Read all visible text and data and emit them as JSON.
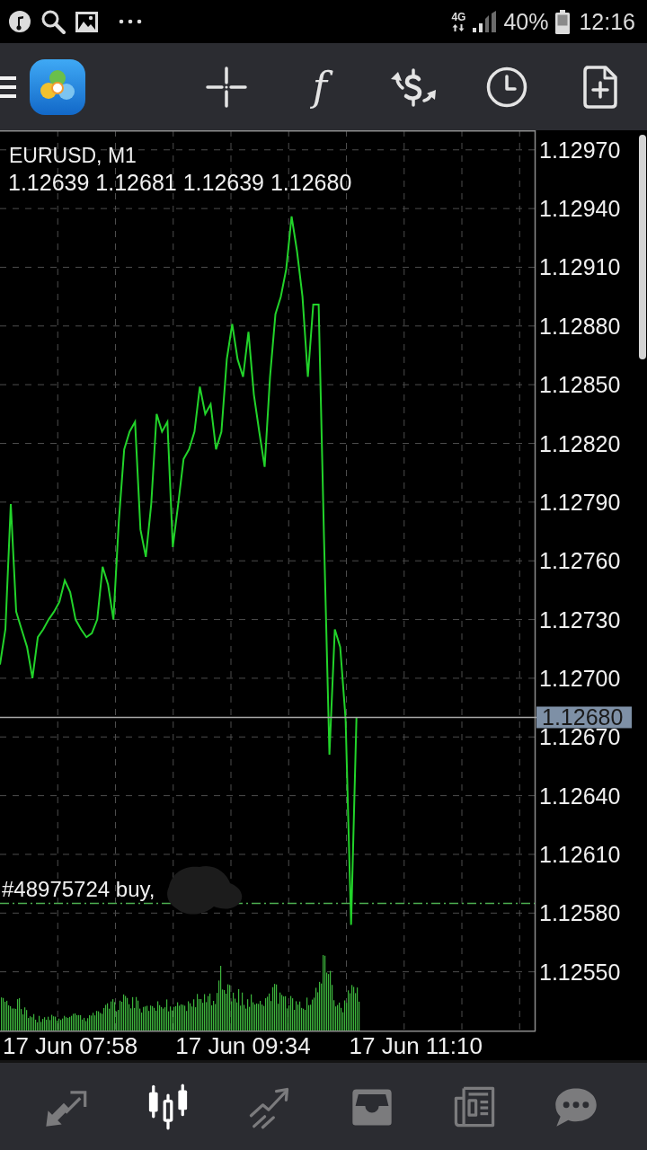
{
  "status_bar": {
    "network_type": "4G",
    "battery_percent": "40%",
    "time": "12:16"
  },
  "toolbar": {
    "buttons": [
      {
        "kind": "crosshair"
      },
      {
        "kind": "glyph",
        "glyph": "f"
      },
      {
        "kind": "dollar_arrows"
      },
      {
        "kind": "clock"
      },
      {
        "kind": "doc_plus"
      }
    ]
  },
  "chart": {
    "ohlc": "1.12639 1.12681 1.12639 1.12680",
    "chart_data": {
      "type": "line",
      "title": "EURUSD, M1",
      "grid": true,
      "categories": [
        null,
        null,
        null,
        null,
        null,
        null,
        null,
        null,
        null,
        null,
        null,
        null,
        null,
        "17 Jun 07:58",
        null,
        null,
        null,
        null,
        null,
        null,
        null,
        null,
        null,
        null,
        null,
        null,
        null,
        null,
        null,
        null,
        null,
        null,
        null,
        null,
        null,
        null,
        null,
        null,
        null,
        null,
        null,
        null,
        null,
        null,
        null,
        "17 Jun 09:34",
        null,
        null,
        null,
        null,
        null,
        null,
        null,
        null,
        null,
        null,
        null,
        null,
        null,
        null,
        null,
        null,
        null,
        null,
        null,
        null,
        null,
        null,
        null,
        null,
        null,
        null,
        null,
        null,
        null,
        null,
        null,
        "17 Jun 11:10",
        null,
        null,
        null,
        null,
        null,
        null,
        null,
        null,
        null,
        null,
        null,
        null,
        null,
        null,
        null,
        null,
        null,
        null,
        null,
        null,
        null,
        null
      ],
      "series": [
        {
          "color": "#22d32a",
          "values": [
            1.12707,
            1.12725,
            1.12789,
            1.12734,
            1.12725,
            1.12716,
            1.127,
            1.12721,
            1.12725,
            1.1273,
            1.12734,
            1.12739,
            1.1275,
            1.12744,
            1.1273,
            1.12725,
            1.12721,
            1.12723,
            1.1273,
            1.12757,
            1.12748,
            1.1273,
            1.1278,
            1.12817,
            1.12826,
            1.12831,
            1.12776,
            1.12762,
            1.12789,
            1.12835,
            1.12826,
            1.12831,
            1.12767,
            1.12789,
            1.12812,
            1.12817,
            1.12826,
            1.12849,
            1.12835,
            1.1284,
            1.12817,
            1.12826,
            1.12863,
            1.12881,
            1.12863,
            1.12854,
            1.12877,
            1.12845,
            1.12826,
            1.12808,
            1.12854,
            1.12886,
            1.12895,
            1.12909,
            1.12936,
            1.12918,
            1.12895,
            1.12854,
            1.12891,
            1.12891,
            1.12771,
            1.12661,
            1.12725,
            1.12716,
            1.12679,
            1.12574,
            1.1268,
            null,
            null,
            null,
            null,
            null,
            null,
            null,
            null,
            null,
            null,
            null,
            null,
            null,
            null,
            null,
            null,
            null,
            null,
            null,
            null,
            null,
            null,
            null,
            null,
            null,
            null,
            null,
            null,
            null,
            null,
            null,
            null,
            null
          ]
        }
      ],
      "ylim": [
        1.1252,
        1.1298
      ],
      "yticks": [
        {
          "value": 1.1297,
          "label": "1.12970"
        },
        {
          "value": 1.1294,
          "label": "1.12940"
        },
        {
          "value": 1.1291,
          "label": "1.12910"
        },
        {
          "value": 1.1288,
          "label": "1.12880"
        },
        {
          "value": 1.1285,
          "label": "1.12850"
        },
        {
          "value": 1.1282,
          "label": "1.12820"
        },
        {
          "value": 1.1279,
          "label": "1.12790"
        },
        {
          "value": 1.1276,
          "label": "1.12760"
        },
        {
          "value": 1.1273,
          "label": "1.12730"
        },
        {
          "value": 1.127,
          "label": "1.12700"
        },
        {
          "value": 1.1267,
          "label": "1.12670"
        },
        {
          "value": 1.1264,
          "label": "1.12640"
        },
        {
          "value": 1.1261,
          "label": "1.12610"
        },
        {
          "value": 1.1258,
          "label": "1.12580"
        },
        {
          "value": 1.1255,
          "label": "1.12550"
        }
      ],
      "ref_lines": [
        {
          "axis": "y",
          "value": 1.1268,
          "label": "1.12680",
          "color": "#a8a8a8"
        },
        {
          "axis": "y",
          "value": 1.12585,
          "label": "#48975724 buy,",
          "color": "#4caf50"
        }
      ]
    }
  },
  "bottom_nav": {
    "items": [
      {
        "kind": "arrows",
        "selected": false
      },
      {
        "kind": "candles",
        "selected": true
      },
      {
        "kind": "trend",
        "selected": false
      },
      {
        "kind": "tray",
        "selected": false
      },
      {
        "kind": "newspaper",
        "selected": false
      },
      {
        "kind": "chat",
        "selected": false
      }
    ]
  }
}
